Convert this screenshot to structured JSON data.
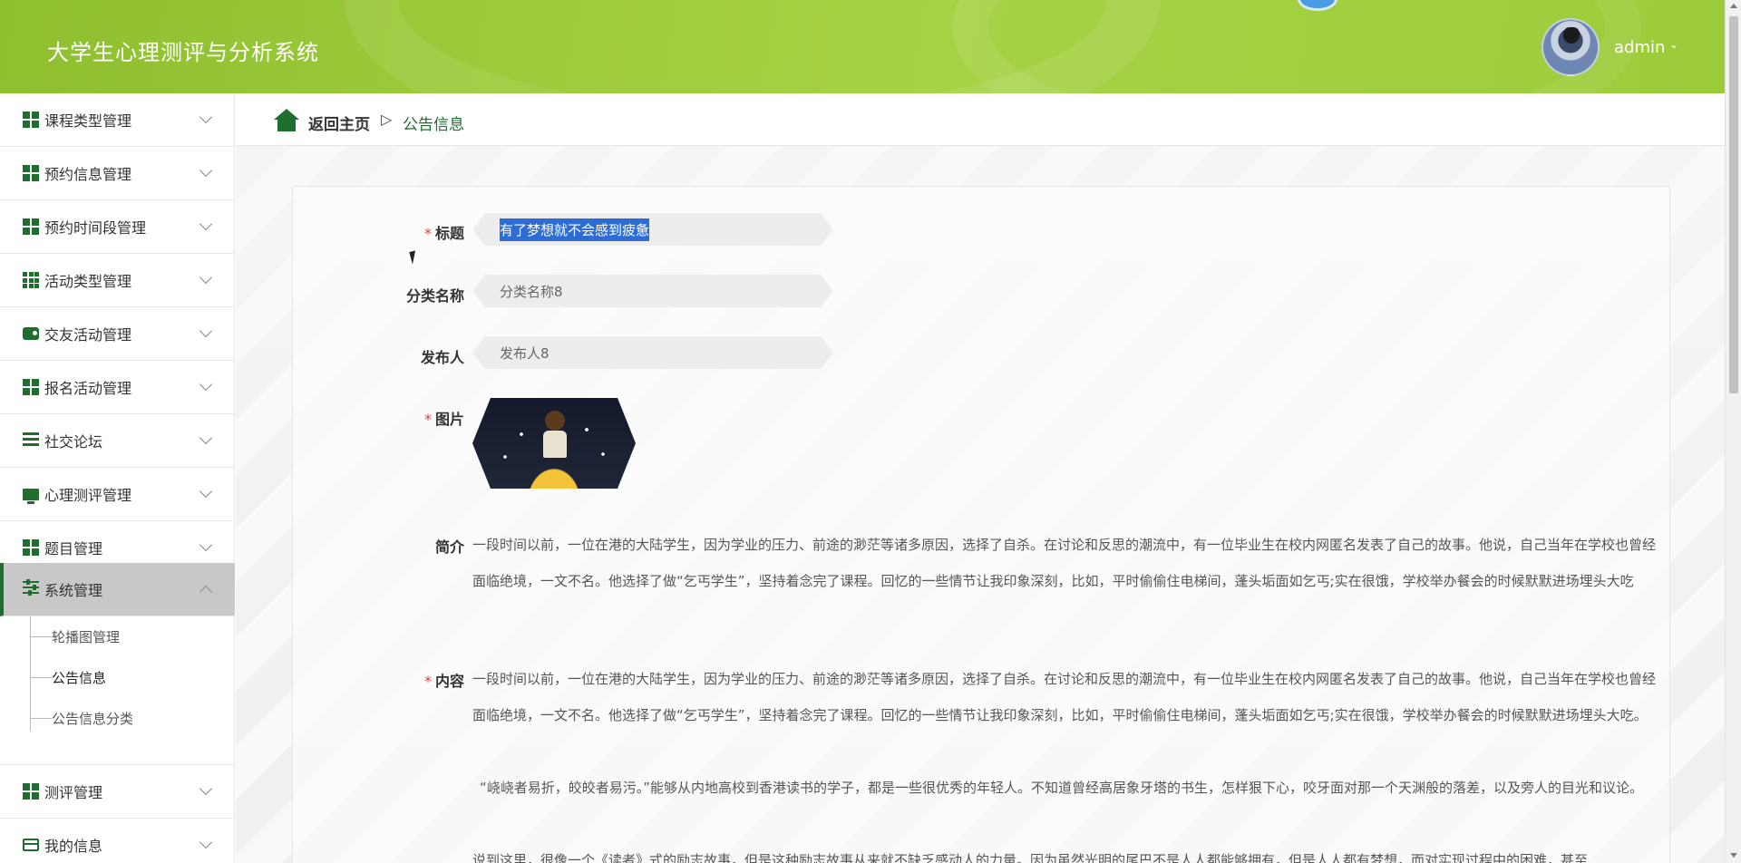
{
  "header": {
    "app_title": "大学生心理测评与分析系统",
    "user_name": "admin",
    "user_chevron": "⌄"
  },
  "sidebar": {
    "items": [
      {
        "label": "课程类型管理",
        "icon": "grid-icon"
      },
      {
        "label": "预约信息管理",
        "icon": "grid-icon"
      },
      {
        "label": "预约时间段管理",
        "icon": "grid-icon"
      },
      {
        "label": "活动类型管理",
        "icon": "grid9-icon"
      },
      {
        "label": "交友活动管理",
        "icon": "wallet-icon"
      },
      {
        "label": "报名活动管理",
        "icon": "grid-icon"
      },
      {
        "label": "社交论坛",
        "icon": "list-icon"
      },
      {
        "label": "心理测评管理",
        "icon": "monitor-icon"
      },
      {
        "label": "题目管理",
        "icon": "grid-icon"
      },
      {
        "label": "系统管理",
        "icon": "sliders-icon",
        "expanded": true
      },
      {
        "label": "测评管理",
        "icon": "grid-icon"
      },
      {
        "label": "我的信息",
        "icon": "card-icon"
      }
    ],
    "submenu": [
      {
        "label": "轮播图管理"
      },
      {
        "label": "公告信息",
        "current": true
      },
      {
        "label": "公告信息分类"
      }
    ]
  },
  "breadcrumb": {
    "home": "返回主页",
    "separator": "▷",
    "current": "公告信息"
  },
  "form": {
    "required_mark": "*",
    "title_label": "标题",
    "title_value": "有了梦想就不会感到疲惫",
    "category_label": "分类名称",
    "category_value": "分类名称8",
    "publisher_label": "发布人",
    "publisher_value": "发布人8",
    "image_label": "图片",
    "intro_label": "简介",
    "intro_text": "一段时间以前，一位在港的大陆学生，因为学业的压力、前途的渺茫等诸多原因，选择了自杀。在讨论和反思的潮流中，有一位毕业生在校内网匿名发表了自己的故事。他说，自己当年在学校也曾经面临绝境，一文不名。他选择了做“乞丐学生”，坚持着念完了课程。回忆的一些情节让我印象深刻，比如，平时偷偷住电梯间，蓬头垢面如乞丐;实在很饿，学校举办餐会的时候默默进场埋头大吃",
    "content_label": "内容",
    "content_p1": "一段时间以前，一位在港的大陆学生，因为学业的压力、前途的渺茫等诸多原因，选择了自杀。在讨论和反思的潮流中，有一位毕业生在校内网匿名发表了自己的故事。他说，自己当年在学校也曾经面临绝境，一文不名。他选择了做“乞丐学生”，坚持着念完了课程。回忆的一些情节让我印象深刻，比如，平时偷偷住电梯间，蓬头垢面如乞丐;实在很饿，学校举办餐会的时候默默进场埋头大吃。",
    "content_p2": "“峣峣者易折，皎皎者易污。”能够从内地高校到香港读书的学子，都是一些很优秀的年轻人。不知道曾经高居象牙塔的书生，怎样狠下心，咬牙面对那一个天渊般的落差，以及旁人的目光和议论。",
    "content_p3": "说到这里，很像一个《读者》式的励志故事，但是这种励志故事从来就不缺乏感动人的力量。因为虽然光明的尾巴不是人人都能够拥有，但是人人都有梦想，而对实现过程中的困难，甚至"
  },
  "colors": {
    "header_green": "#9fcc3c",
    "accent_dark_green": "#1f6e2f",
    "required_red": "#e23c3c",
    "selection_blue": "#2d6cd4"
  }
}
